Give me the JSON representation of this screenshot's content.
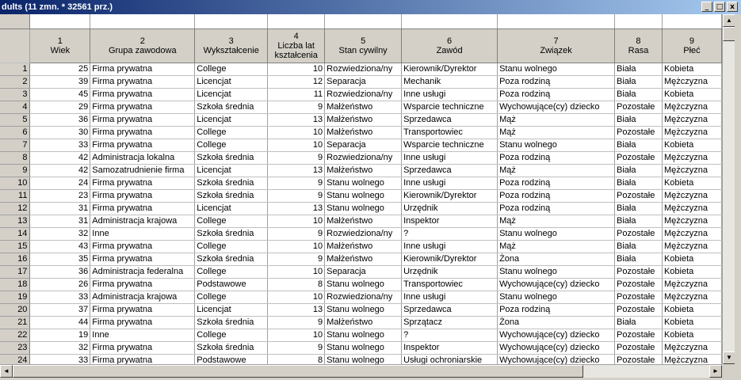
{
  "window": {
    "title": "dults (11 zmn. * 32561 prz.)",
    "buttons": {
      "minimize": "_",
      "restore": "□",
      "close": "x"
    }
  },
  "columns": [
    {
      "num": "1",
      "name": "Wiek"
    },
    {
      "num": "2",
      "name": "Grupa zawodowa"
    },
    {
      "num": "3",
      "name": "Wykształcenie"
    },
    {
      "num": "4",
      "name": "Liczba lat kształcenia"
    },
    {
      "num": "5",
      "name": "Stan cywilny"
    },
    {
      "num": "6",
      "name": "Zawód"
    },
    {
      "num": "7",
      "name": "Związek"
    },
    {
      "num": "8",
      "name": "Rasa"
    },
    {
      "num": "9",
      "name": "Płeć"
    }
  ],
  "rows": [
    [
      "1",
      "25",
      "Firma prywatna",
      "College",
      "10",
      "Rozwiedziona/ny",
      "Kierownik/Dyrektor",
      "Stanu wolnego",
      "Biała",
      "Kobieta"
    ],
    [
      "2",
      "39",
      "Firma prywatna",
      "Licencjat",
      "12",
      "Separacja",
      "Mechanik",
      "Poza rodziną",
      "Biała",
      "Mężczyzna"
    ],
    [
      "3",
      "45",
      "Firma prywatna",
      "Licencjat",
      "11",
      "Rozwiedziona/ny",
      "Inne usługi",
      "Poza rodziną",
      "Biała",
      "Kobieta"
    ],
    [
      "4",
      "29",
      "Firma prywatna",
      "Szkoła średnia",
      "9",
      "Małżeństwo",
      "Wsparcie techniczne",
      "Wychowujące(cy) dziecko",
      "Pozostałe",
      "Mężczyzna"
    ],
    [
      "5",
      "36",
      "Firma prywatna",
      "Licencjat",
      "13",
      "Małżeństwo",
      "Sprzedawca",
      "Mąż",
      "Biała",
      "Mężczyzna"
    ],
    [
      "6",
      "30",
      "Firma prywatna",
      "College",
      "10",
      "Małżeństwo",
      "Transportowiec",
      "Mąż",
      "Pozostałe",
      "Mężczyzna"
    ],
    [
      "7",
      "33",
      "Firma prywatna",
      "College",
      "10",
      "Separacja",
      "Wsparcie techniczne",
      "Stanu wolnego",
      "Biała",
      "Kobieta"
    ],
    [
      "8",
      "42",
      "Administracja lokalna",
      "Szkoła średnia",
      "9",
      "Rozwiedziona/ny",
      "Inne usługi",
      "Poza rodziną",
      "Pozostałe",
      "Mężczyzna"
    ],
    [
      "9",
      "42",
      "Samozatrudnienie firma",
      "Licencjat",
      "13",
      "Małżeństwo",
      "Sprzedawca",
      "Mąż",
      "Biała",
      "Mężczyzna"
    ],
    [
      "10",
      "24",
      "Firma prywatna",
      "Szkoła średnia",
      "9",
      "Stanu wolnego",
      "Inne usługi",
      "Poza rodziną",
      "Biała",
      "Kobieta"
    ],
    [
      "11",
      "23",
      "Firma prywatna",
      "Szkoła średnia",
      "9",
      "Stanu wolnego",
      "Kierownik/Dyrektor",
      "Poza rodziną",
      "Pozostałe",
      "Mężczyzna"
    ],
    [
      "12",
      "31",
      "Firma prywatna",
      "Licencjat",
      "13",
      "Stanu wolnego",
      "Urzędnik",
      "Poza rodziną",
      "Biała",
      "Mężczyzna"
    ],
    [
      "13",
      "31",
      "Administracja krajowa",
      "College",
      "10",
      "Małżeństwo",
      "Inspektor",
      "Mąż",
      "Biała",
      "Mężczyzna"
    ],
    [
      "14",
      "32",
      "Inne",
      "Szkoła średnia",
      "9",
      "Rozwiedziona/ny",
      "?",
      "Stanu wolnego",
      "Pozostałe",
      "Mężczyzna"
    ],
    [
      "15",
      "43",
      "Firma prywatna",
      "College",
      "10",
      "Małżeństwo",
      "Inne usługi",
      "Mąż",
      "Biała",
      "Mężczyzna"
    ],
    [
      "16",
      "35",
      "Firma prywatna",
      "Szkoła średnia",
      "9",
      "Małżeństwo",
      "Kierownik/Dyrektor",
      "Żona",
      "Biała",
      "Kobieta"
    ],
    [
      "17",
      "36",
      "Administracja federalna",
      "College",
      "10",
      "Separacja",
      "Urzędnik",
      "Stanu wolnego",
      "Pozostałe",
      "Kobieta"
    ],
    [
      "18",
      "26",
      "Firma prywatna",
      "Podstawowe",
      "8",
      "Stanu wolnego",
      "Transportowiec",
      "Wychowujące(cy) dziecko",
      "Pozostałe",
      "Mężczyzna"
    ],
    [
      "19",
      "33",
      "Administracja krajowa",
      "College",
      "10",
      "Rozwiedziona/ny",
      "Inne usługi",
      "Stanu wolnego",
      "Pozostałe",
      "Mężczyzna"
    ],
    [
      "20",
      "37",
      "Firma prywatna",
      "Licencjat",
      "13",
      "Stanu wolnego",
      "Sprzedawca",
      "Poza rodziną",
      "Pozostałe",
      "Kobieta"
    ],
    [
      "21",
      "44",
      "Firma prywatna",
      "Szkoła średnia",
      "9",
      "Małżeństwo",
      "Sprzątacz",
      "Żona",
      "Biała",
      "Kobieta"
    ],
    [
      "22",
      "19",
      "Inne",
      "College",
      "10",
      "Stanu wolnego",
      "?",
      "Wychowujące(cy) dziecko",
      "Pozostałe",
      "Kobieta"
    ],
    [
      "23",
      "32",
      "Firma prywatna",
      "Szkoła średnia",
      "9",
      "Stanu wolnego",
      "Inspektor",
      "Wychowujące(cy) dziecko",
      "Pozostałe",
      "Mężczyzna"
    ],
    [
      "24",
      "33",
      "Firma prywatna",
      "Podstawowe",
      "8",
      "Stanu wolnego",
      "Usługi ochroniarskie",
      "Wychowujące(cy) dziecko",
      "Pozostałe",
      "Mężczyzna"
    ]
  ]
}
